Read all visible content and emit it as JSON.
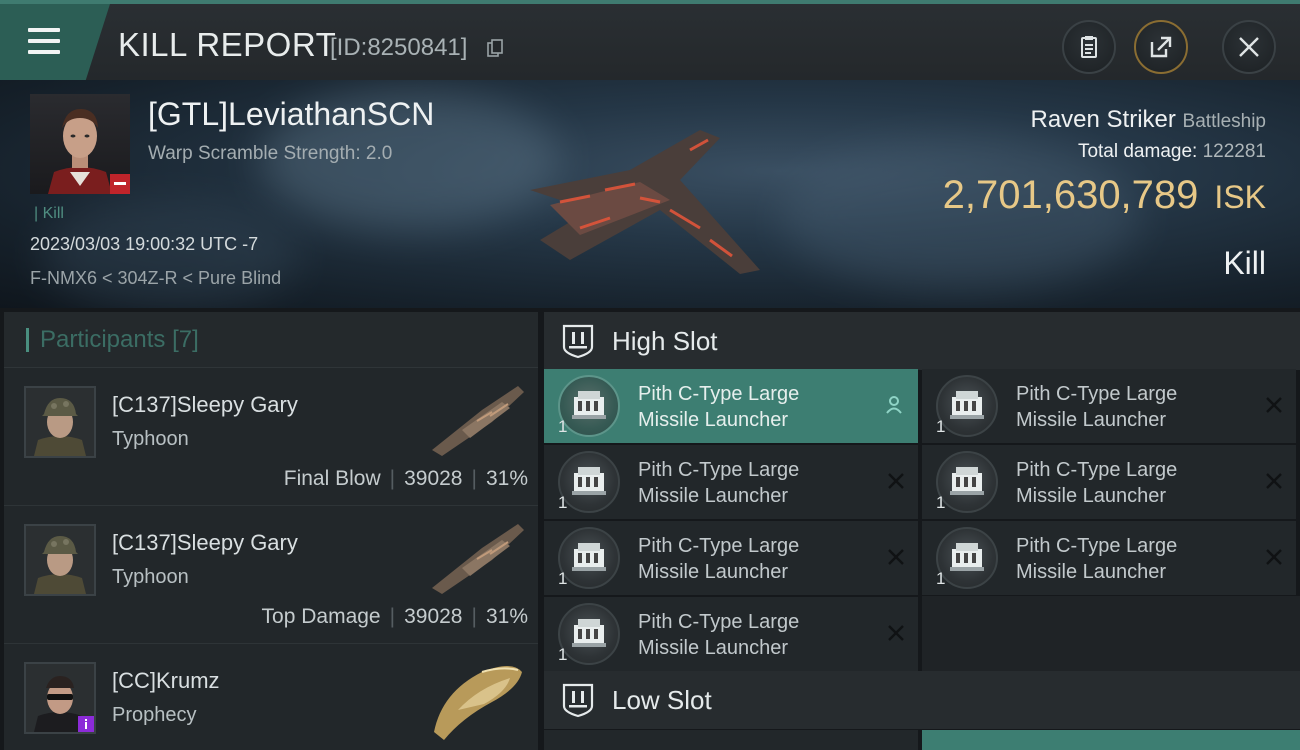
{
  "header": {
    "title": "KILL REPORT",
    "id_text": "[ID:8250841]"
  },
  "victim": {
    "name": "[GTL]LeviathanSCN",
    "scram_text": "Warp Scramble Strength: 2.0",
    "kill_tag": "Kill",
    "timestamp": "2023/03/03 19:00:32 UTC -7",
    "location": "F-NMX6 < 304Z-R < Pure Blind",
    "ship_name": "Raven Striker",
    "ship_class": "Battleship",
    "total_damage_label": "Total damage:",
    "total_damage_value": "122281",
    "isk_value": "2,701,630,789",
    "isk_unit": "ISK",
    "result": "Kill"
  },
  "participants": {
    "label": "Participants",
    "count": "[7]",
    "rows": [
      {
        "name": "[C137]Sleepy Gary",
        "ship": "Typhoon",
        "role": "Final Blow",
        "damage": "39028",
        "percent": "31%"
      },
      {
        "name": "[C137]Sleepy Gary",
        "ship": "Typhoon",
        "role": "Top Damage",
        "damage": "39028",
        "percent": "31%"
      },
      {
        "name": "[CC]Krumz",
        "ship": "Prophecy"
      }
    ]
  },
  "high_slot": {
    "label": "High Slot",
    "modules": [
      {
        "line1": "Pith C-Type Large",
        "line2": "Missile Launcher",
        "qty": "1"
      },
      {
        "line1": "Pith C-Type Large",
        "line2": "Missile Launcher",
        "qty": "1"
      },
      {
        "line1": "Pith C-Type Large",
        "line2": "Missile Launcher",
        "qty": "1"
      },
      {
        "line1": "Pith C-Type Large",
        "line2": "Missile Launcher",
        "qty": "1"
      },
      {
        "line1": "Pith C-Type Large",
        "line2": "Missile Launcher",
        "qty": "1"
      },
      {
        "line1": "Pith C-Type Large",
        "line2": "Missile Launcher",
        "qty": "1"
      },
      {
        "line1": "Pith C-Type Large",
        "line2": "Missile Launcher",
        "qty": "1"
      }
    ]
  },
  "low_slot": {
    "label": "Low Slot"
  },
  "icons": {
    "menu": "hamburger-icon",
    "copy": "copy-icon",
    "clipboard": "clipboard-icon",
    "share": "share-icon",
    "close": "close-icon",
    "slot": "shield-icon",
    "dropped": "person-icon",
    "destroyed": "x-icon"
  },
  "colors": {
    "accent_teal": "#3d7e72",
    "isk_gold": "#e7c887",
    "background": "#15181b"
  }
}
